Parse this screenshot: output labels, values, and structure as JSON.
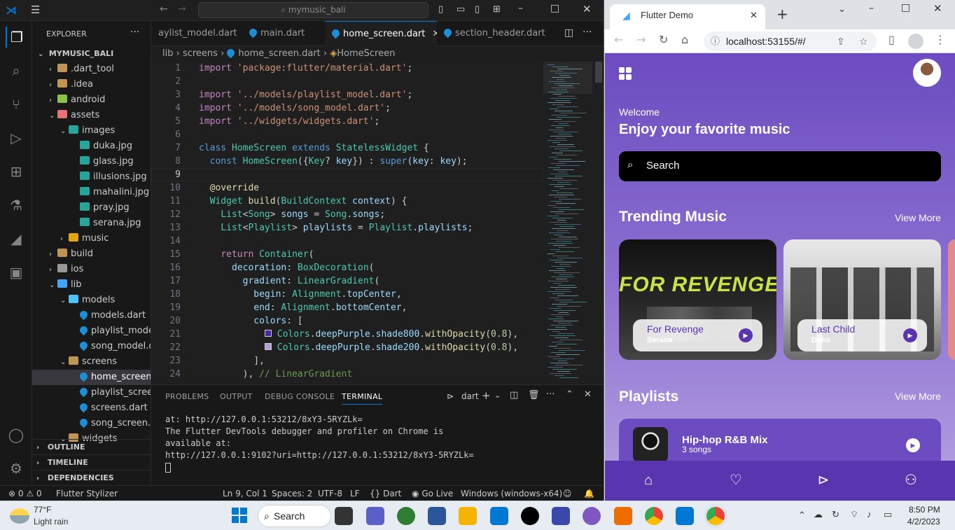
{
  "vscode": {
    "search_text": "mymusic_bali",
    "explorer_title": "EXPLORER",
    "project_name": "MYMUSIC_BALI",
    "tree": [
      {
        "label": ".dart_tool",
        "type": "folder",
        "level": 1,
        "chev": "›"
      },
      {
        "label": ".idea",
        "type": "folder",
        "level": 1,
        "chev": "›"
      },
      {
        "label": "android",
        "type": "android",
        "level": 1,
        "chev": "›"
      },
      {
        "label": "assets",
        "type": "assets",
        "level": 1,
        "chev": "⌄"
      },
      {
        "label": "images",
        "type": "img-folder",
        "level": 2,
        "chev": "⌄"
      },
      {
        "label": "duka.jpg",
        "type": "img",
        "level": 3,
        "chev": ""
      },
      {
        "label": "glass.jpg",
        "type": "img",
        "level": 3,
        "chev": ""
      },
      {
        "label": "illusions.jpg",
        "type": "img",
        "level": 3,
        "chev": ""
      },
      {
        "label": "mahalini.jpg",
        "type": "img",
        "level": 3,
        "chev": ""
      },
      {
        "label": "pray.jpg",
        "type": "img",
        "level": 3,
        "chev": ""
      },
      {
        "label": "serana.jpg",
        "type": "img",
        "level": 3,
        "chev": ""
      },
      {
        "label": "music",
        "type": "music",
        "level": 2,
        "chev": "›"
      },
      {
        "label": "build",
        "type": "folder",
        "level": 1,
        "chev": "›"
      },
      {
        "label": "ios",
        "type": "ios",
        "level": 1,
        "chev": "›"
      },
      {
        "label": "lib",
        "type": "lib",
        "level": 1,
        "chev": "⌄"
      },
      {
        "label": "models",
        "type": "models",
        "level": 2,
        "chev": "⌄"
      },
      {
        "label": "models.dart",
        "type": "dart",
        "level": 3,
        "chev": ""
      },
      {
        "label": "playlist_model....",
        "type": "dart",
        "level": 3,
        "chev": ""
      },
      {
        "label": "song_model.dart",
        "type": "dart",
        "level": 3,
        "chev": ""
      },
      {
        "label": "screens",
        "type": "scr",
        "level": 2,
        "chev": "⌄"
      },
      {
        "label": "home_screen.d...",
        "type": "dart",
        "level": 3,
        "chev": "",
        "selected": true
      },
      {
        "label": "playlist_screen....",
        "type": "dart",
        "level": 3,
        "chev": ""
      },
      {
        "label": "screens.dart",
        "type": "dart",
        "level": 3,
        "chev": ""
      },
      {
        "label": "song_screen.dart",
        "type": "dart",
        "level": 3,
        "chev": ""
      },
      {
        "label": "widgets",
        "type": "folder",
        "level": 2,
        "chev": "⌄"
      }
    ],
    "outline_label": "OUTLINE",
    "timeline_label": "TIMELINE",
    "dependencies_label": "DEPENDENCIES",
    "tabs": [
      {
        "label": "aylist_model.dart"
      },
      {
        "label": "main.dart"
      },
      {
        "label": "home_screen.dart",
        "active": true
      },
      {
        "label": "section_header.dart"
      }
    ],
    "breadcrumb": [
      "lib",
      "screens",
      "home_screen.dart",
      "HomeScreen"
    ],
    "line_numbers": [
      "1",
      "2",
      "3",
      "4",
      "5",
      "6",
      "7",
      "8",
      "9",
      "10",
      "11",
      "12",
      "13",
      "14",
      "15",
      "16",
      "17",
      "18",
      "19",
      "20",
      "21",
      "22",
      "23",
      "24"
    ],
    "panel_tabs": [
      "PROBLEMS",
      "OUTPUT",
      "DEBUG CONSOLE",
      "TERMINAL"
    ],
    "terminal_label": "dart",
    "terminal_lines": [
      "at: http://127.0.0.1:53212/8xY3-5RYZLk=",
      "The Flutter DevTools debugger and profiler on Chrome is",
      "available at:",
      "http://127.0.0.1:9102?uri=http://127.0.0.1:53212/8xY3-5RYZLk="
    ],
    "status": {
      "errors": "0",
      "warnings": "0",
      "flutter_stylizer": "Flutter Stylizer",
      "position": "Ln 9, Col 1",
      "spaces": "Spaces: 2",
      "encoding": "UTF-8",
      "eol": "LF",
      "language": "Dart",
      "golive": "Go Live",
      "device": "Windows (windows-x64)"
    }
  },
  "browser": {
    "tab_title": "Flutter Demo",
    "url": "localhost:53155/#/",
    "app": {
      "welcome": "Welcome",
      "headline": "Enjoy your favorite music",
      "search_placeholder": "Search",
      "trending_title": "Trending Music",
      "trending_more": "View More",
      "cards": [
        {
          "title": "For Revenge",
          "artist": "Serana",
          "banner": "FOR REVENGE"
        },
        {
          "title": "Last Child",
          "artist": "Duka"
        }
      ],
      "playlists_title": "Playlists",
      "playlists_more": "View More",
      "playlist": {
        "title": "Hip-hop R&B Mix",
        "subtitle": "3 songs"
      }
    }
  },
  "taskbar": {
    "weather_temp": "77°F",
    "weather_desc": "Light rain",
    "search_label": "Search",
    "time": "8:50 PM",
    "date": "4/2/2023"
  },
  "colors": {
    "accent": "#0078d4",
    "app_purple": "#6c4cc0",
    "nav_purple": "#5a35b0"
  }
}
